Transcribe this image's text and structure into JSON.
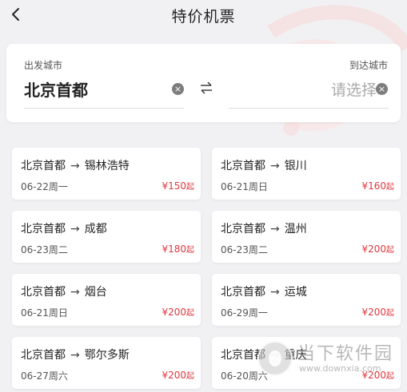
{
  "header": {
    "title": "特价机票",
    "back_icon": "chevron-left-icon"
  },
  "search": {
    "from_label": "出发城市",
    "from_city": "北京首都",
    "to_label": "到达城市",
    "to_placeholder": "请选择",
    "clear_glyph": "×",
    "swap_icon": "swap-arrows-icon"
  },
  "arrow_glyph": "→",
  "price_suffix": "起",
  "flights": [
    {
      "from": "北京首都",
      "to": "锡林浩特",
      "date": "06-22周一",
      "price": "¥150"
    },
    {
      "from": "北京首都",
      "to": "银川",
      "date": "06-21周日",
      "price": "¥160"
    },
    {
      "from": "北京首都",
      "to": "成都",
      "date": "06-23周二",
      "price": "¥180"
    },
    {
      "from": "北京首都",
      "to": "温州",
      "date": "06-23周二",
      "price": "¥200"
    },
    {
      "from": "北京首都",
      "to": "烟台",
      "date": "06-21周日",
      "price": "¥200"
    },
    {
      "from": "北京首都",
      "to": "运城",
      "date": "06-29周一",
      "price": "¥200"
    },
    {
      "from": "北京首都",
      "to": "鄂尔多斯",
      "date": "06-27周六",
      "price": "¥200"
    },
    {
      "from": "北京首都",
      "to": "重庆",
      "date": "06-20周六",
      "price": "¥200"
    }
  ],
  "watermark": {
    "text": "当下软件园",
    "url": "www.downxia.com"
  },
  "colors": {
    "price": "#e0383e",
    "background": "#f1f1f3",
    "card": "#ffffff"
  }
}
